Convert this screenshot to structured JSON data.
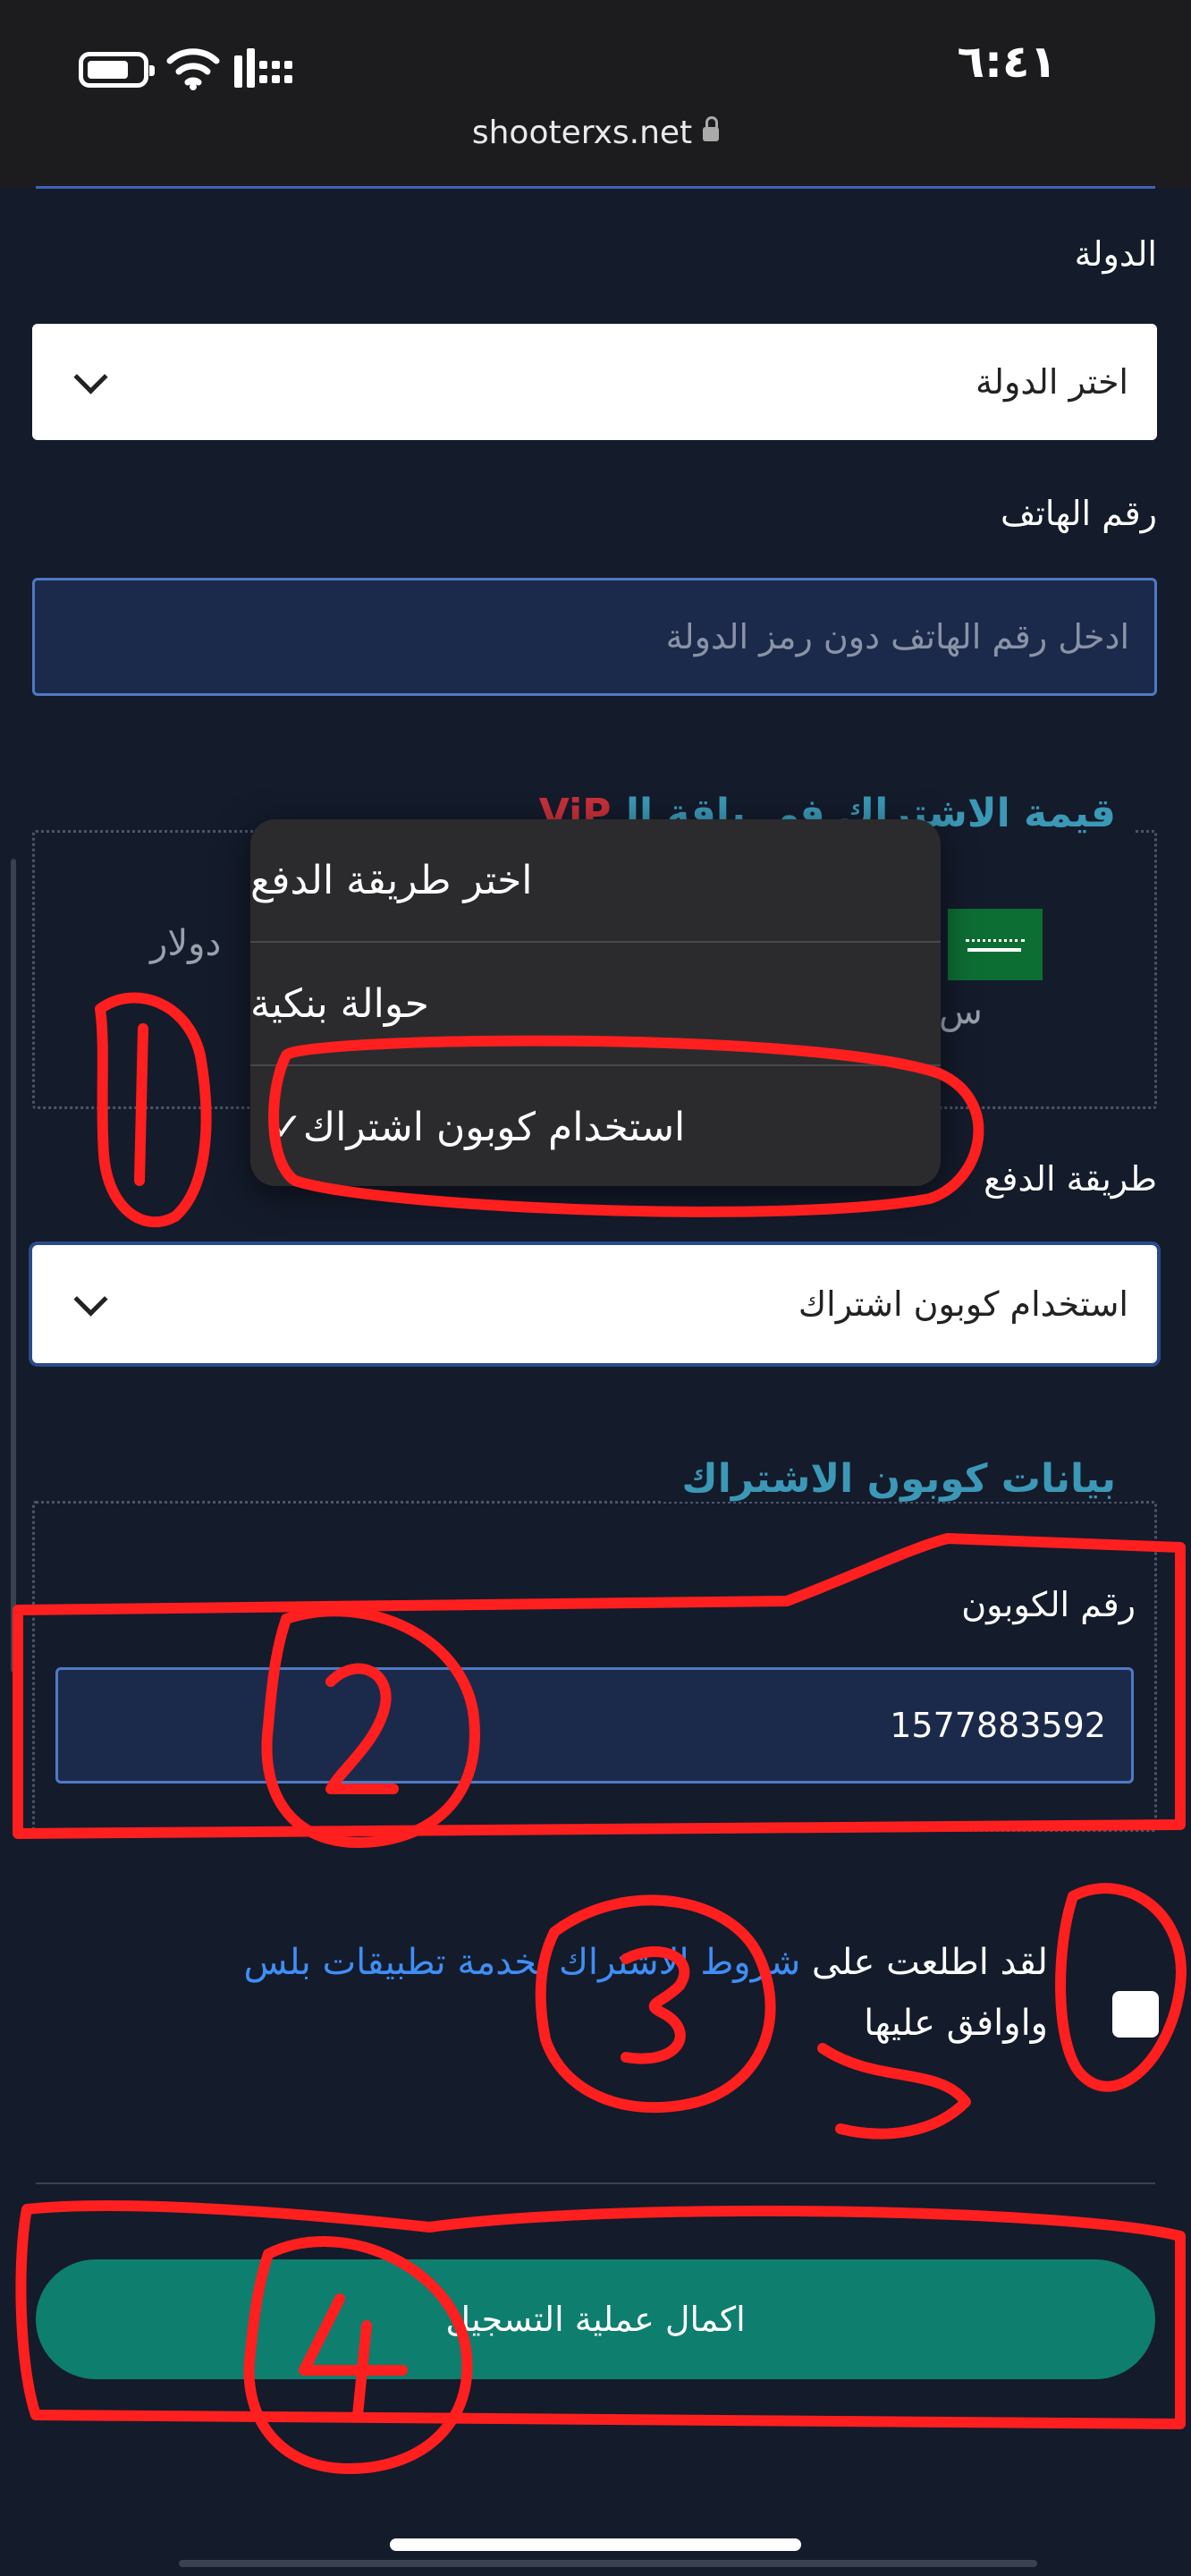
{
  "status_bar": {
    "time": "٦:٤١",
    "url": "shooterxs.net"
  },
  "form": {
    "country": {
      "label": "الدولة",
      "selected": "اختر الدولة"
    },
    "phone": {
      "label": "رقم الهاتف",
      "placeholder": "ادخل رقم الهاتف دون رمز الدولة"
    },
    "subscription_value": {
      "legend": "قيمة الاشتراك في باقة الـ",
      "legend_highlight": "ViP",
      "amount_unit": "دولار",
      "partial_text": "س"
    },
    "payment_method": {
      "label": "طريقة الدفع",
      "selected": "استخدام كوبون اشتراك"
    },
    "coupon_section": {
      "legend": "بيانات كوبون الاشتراك",
      "coupon_label": "رقم الكوبون",
      "coupon_value": "1577883592"
    },
    "terms": {
      "prefix": "لقد اطلعت على ",
      "link": "شروط الاشتراك بخدمة تطبيقات بلس",
      "suffix": "واوافق عليها",
      "checked": false
    },
    "submit_label": "اكمال عملية التسجيل"
  },
  "payment_menu": {
    "items": [
      {
        "label": "اختر طريقة الدفع",
        "checked": false
      },
      {
        "label": "حوالة بنكية",
        "checked": false
      },
      {
        "label": "استخدام كوبون اشتراك",
        "checked": true
      }
    ],
    "check_glyph": "✓"
  },
  "annotations": {
    "color": "#ff1f1f",
    "numbers": [
      "1",
      "2",
      "3",
      "4",
      "5"
    ]
  }
}
